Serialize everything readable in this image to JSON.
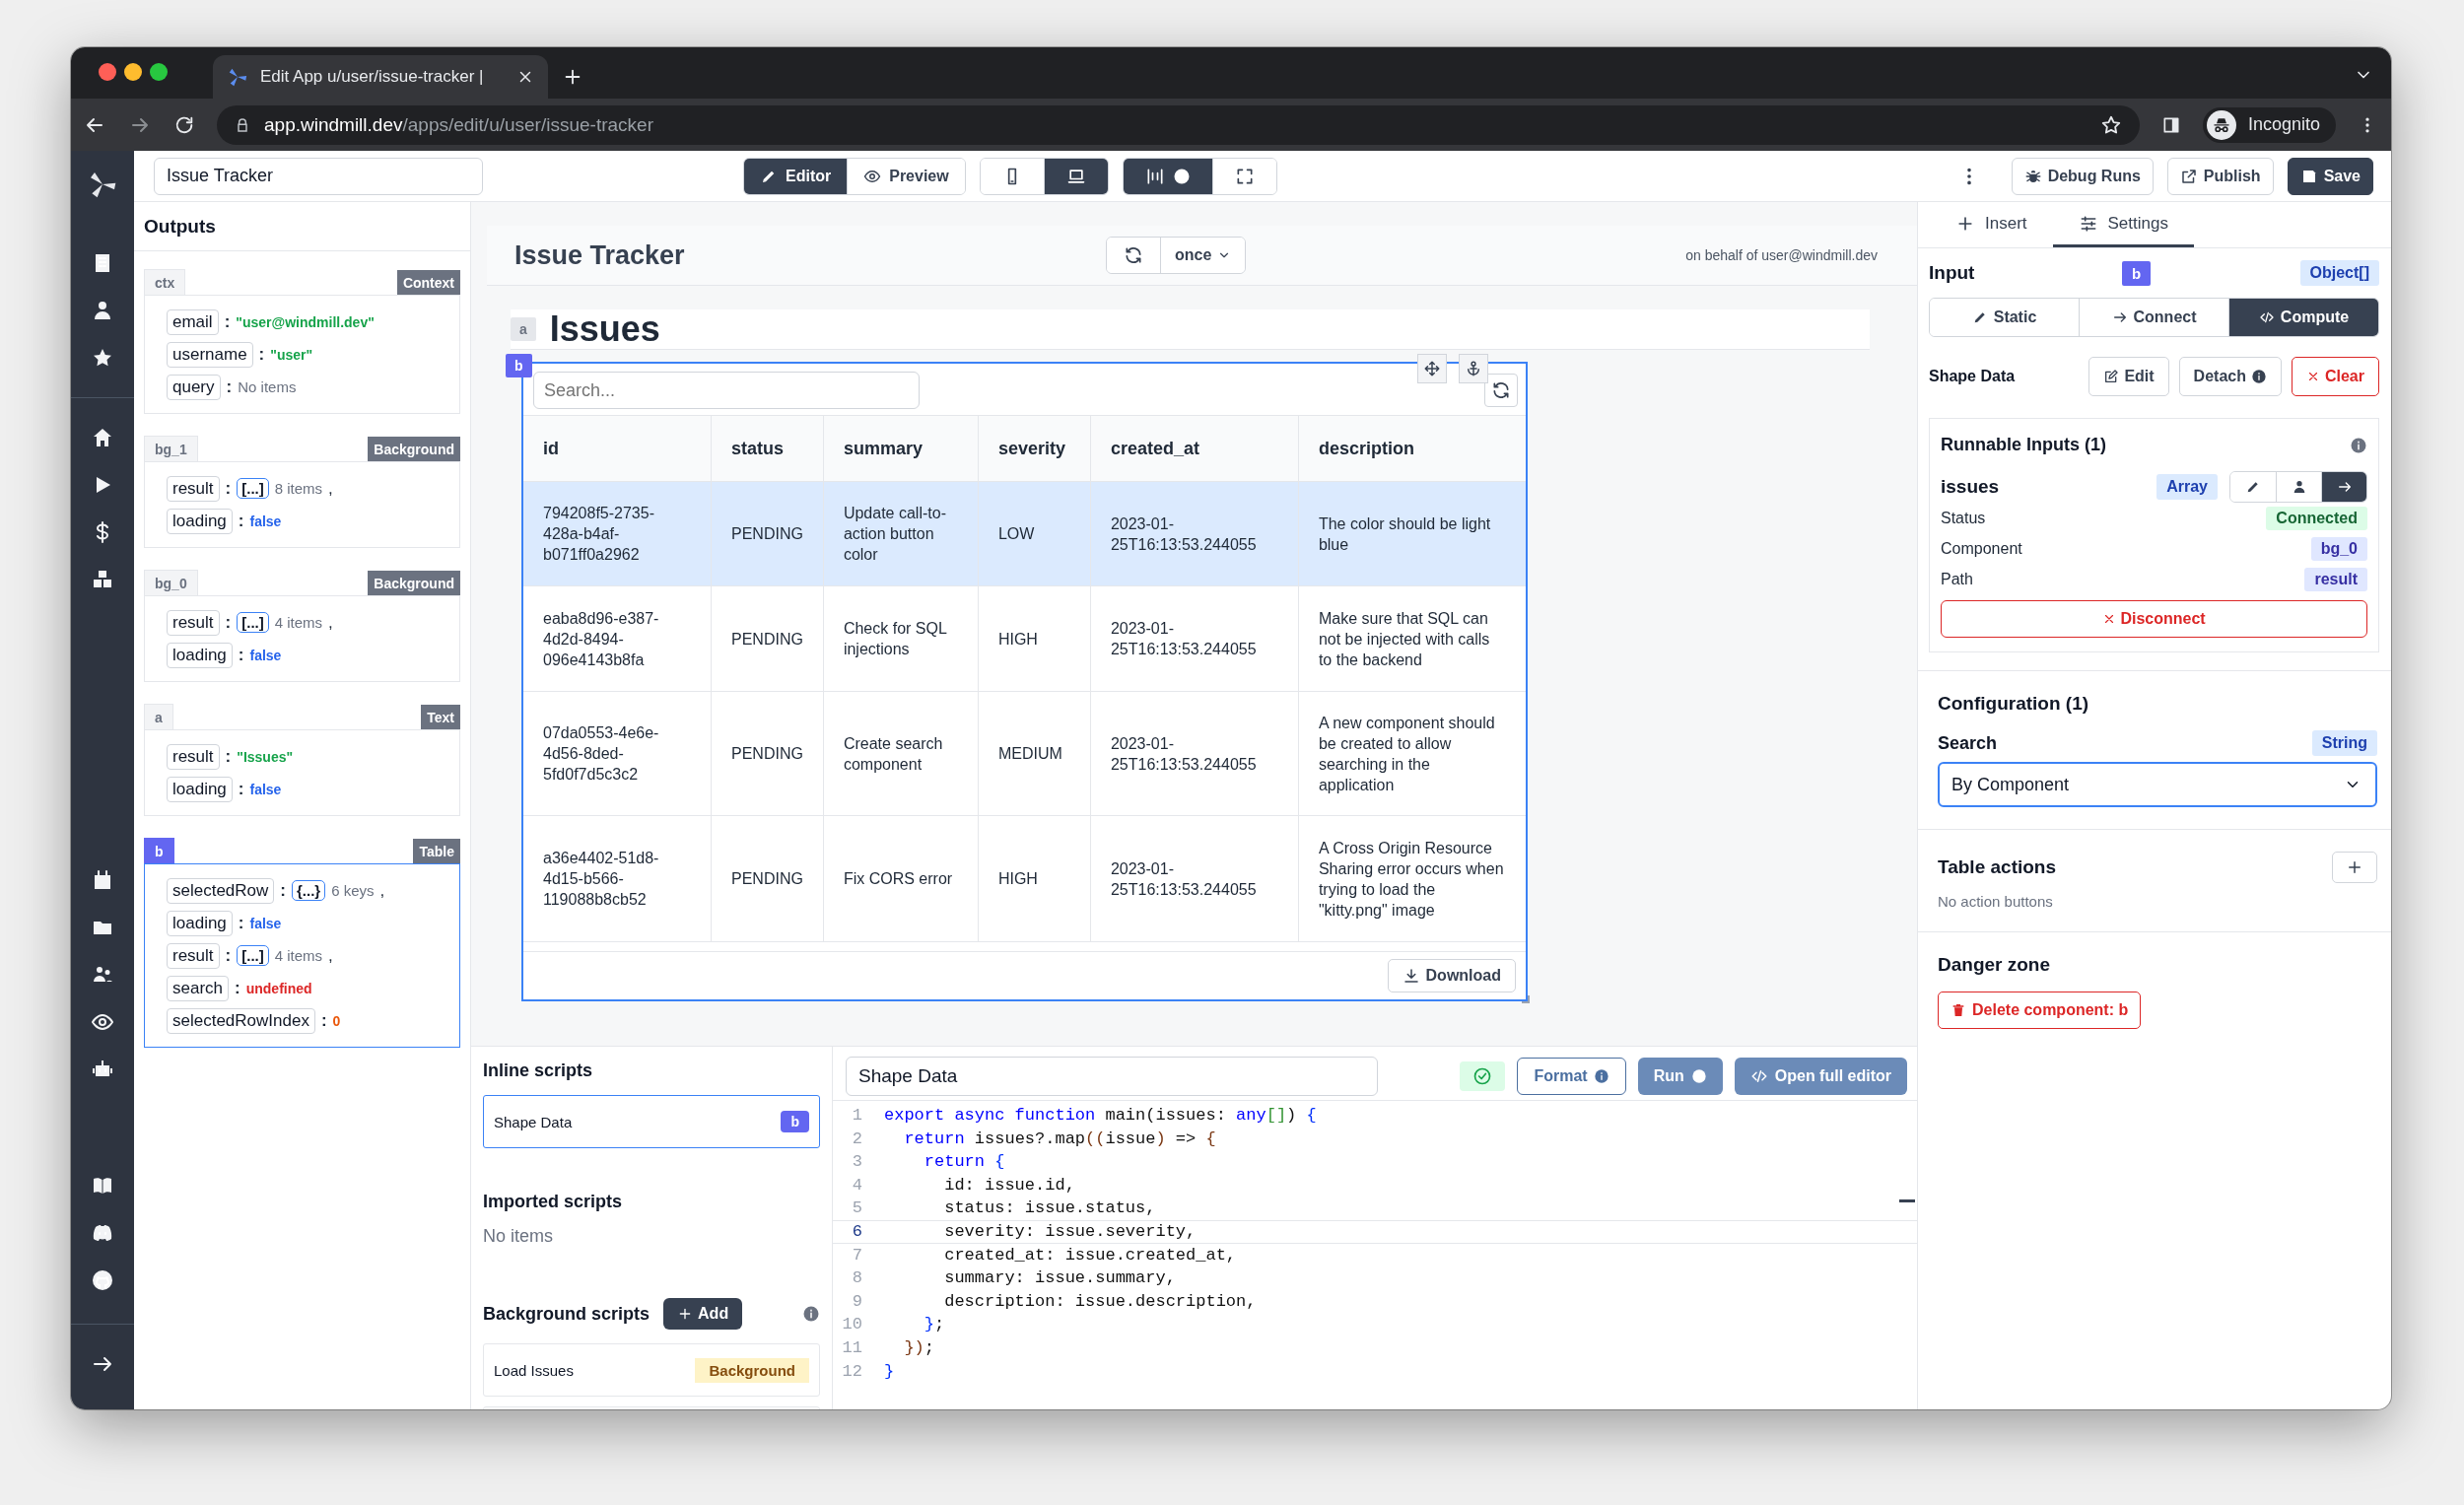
{
  "browser": {
    "tab_title": "Edit App u/user/issue-tracker |",
    "url_host": "app.windmill.dev",
    "url_path": "/apps/edit/u/user/issue-tracker",
    "profile": "Incognito"
  },
  "toolbar": {
    "app_name": "Issue Tracker",
    "modes": [
      {
        "label": "Editor",
        "kind": "editor",
        "selected": true
      },
      {
        "label": "Preview",
        "kind": "preview",
        "selected": false
      }
    ],
    "devices": [
      {
        "kind": "mobile",
        "selected": false
      },
      {
        "kind": "desktop",
        "selected": true
      }
    ],
    "actions": [
      {
        "label": "Debug Runs",
        "kind": "debug"
      },
      {
        "label": "Publish",
        "kind": "publish"
      },
      {
        "label": "Save",
        "kind": "save"
      }
    ]
  },
  "outputs": {
    "title": "Outputs",
    "separator": ":",
    "groups": [
      {
        "id": "ctx",
        "type": "Context",
        "selected": false,
        "fields": [
          {
            "key": "email",
            "kind": "string",
            "value": "\"user@windmill.dev\""
          },
          {
            "key": "username",
            "kind": "string",
            "value": "\"user\""
          },
          {
            "key": "query",
            "kind": "empty",
            "value": "No items"
          }
        ]
      },
      {
        "id": "bg_1",
        "type": "Background",
        "selected": false,
        "fields": [
          {
            "key": "result",
            "kind": "array",
            "value": "[...]",
            "count": "8 items",
            "trailing": ","
          },
          {
            "key": "loading",
            "kind": "boolean",
            "value": "false"
          }
        ]
      },
      {
        "id": "bg_0",
        "type": "Background",
        "selected": false,
        "fields": [
          {
            "key": "result",
            "kind": "array",
            "value": "[...]",
            "count": "4 items",
            "trailing": ","
          },
          {
            "key": "loading",
            "kind": "boolean",
            "value": "false"
          }
        ]
      },
      {
        "id": "a",
        "type": "Text",
        "selected": false,
        "fields": [
          {
            "key": "result",
            "kind": "string",
            "value": "\"Issues\""
          },
          {
            "key": "loading",
            "kind": "boolean",
            "value": "false"
          }
        ]
      },
      {
        "id": "b",
        "type": "Table",
        "selected": true,
        "fields": [
          {
            "key": "selectedRow",
            "kind": "object",
            "value": "{...}",
            "count": "6 keys",
            "trailing": ","
          },
          {
            "key": "loading",
            "kind": "boolean",
            "value": "false"
          },
          {
            "key": "result",
            "kind": "array",
            "value": "[...]",
            "count": "4 items",
            "trailing": ","
          },
          {
            "key": "search",
            "kind": "undefined",
            "value": "undefined"
          },
          {
            "key": "selectedRowIndex",
            "kind": "number",
            "value": "0"
          }
        ]
      }
    ]
  },
  "canvas": {
    "title": "Issue Tracker",
    "refresh": "once",
    "run_as": "on behalf of user@windmill.dev",
    "text_component": {
      "id": "a",
      "text": "Issues"
    },
    "table": {
      "id": "b",
      "selected": true,
      "search_placeholder": "Search...",
      "columns": [
        "id",
        "status",
        "summary",
        "severity",
        "created_at",
        "description"
      ],
      "rows": [
        {
          "selected": true,
          "cells": [
            "794208f5-2735-428a-b4af-b071ff0a2962",
            "PENDING",
            "Update call-to-action button color",
            "LOW",
            "2023-01-25T16:13:53.244055",
            "The color should be light blue"
          ]
        },
        {
          "selected": false,
          "cells": [
            "eaba8d96-e387-4d2d-8494-096e4143b8fa",
            "PENDING",
            "Check for SQL injections",
            "HIGH",
            "2023-01-25T16:13:53.244055",
            "Make sure that SQL can not be injected with calls to the backend"
          ]
        },
        {
          "selected": false,
          "cells": [
            "07da0553-4e6e-4d56-8ded-5fd0f7d5c3c2",
            "PENDING",
            "Create search component",
            "MEDIUM",
            "2023-01-25T16:13:53.244055",
            "A new component should be created to allow searching in the application"
          ]
        },
        {
          "selected": false,
          "cells": [
            "a36e4402-51d8-4d15-b566-119088b8cb52",
            "PENDING",
            "Fix CORS error",
            "HIGH",
            "2023-01-25T16:13:53.244055",
            "A Cross Origin Resource Sharing error occurs when trying to load the \"kitty.png\" image"
          ]
        }
      ],
      "download": "Download"
    }
  },
  "scripts": {
    "inline_title": "Inline scripts",
    "inline": [
      {
        "name": "Shape Data",
        "component": "b",
        "selected": true
      }
    ],
    "imported_title": "Imported scripts",
    "imported_empty": "No items",
    "background_title": "Background scripts",
    "add_label": "Add",
    "background": [
      {
        "name": "Load Issues",
        "tag": "Background"
      }
    ]
  },
  "editor": {
    "script_name": "Shape Data",
    "format": "Format",
    "run": "Run",
    "open_full": "Open full editor",
    "lines": [
      {
        "number": "1",
        "current": false,
        "segments": [
          {
            "text": "export async function",
            "kind": "kw"
          },
          {
            "text": " main(issues: ",
            "kind": "plain"
          },
          {
            "text": "any",
            "kind": "kw"
          },
          {
            "text": "[]",
            "kind": "br3"
          },
          {
            "text": ") ",
            "kind": "plain"
          },
          {
            "text": "{",
            "kind": "br1"
          }
        ]
      },
      {
        "number": "2",
        "current": false,
        "segments": [
          {
            "text": "  return",
            "kind": "kw"
          },
          {
            "text": " issues?.map",
            "kind": "plain"
          },
          {
            "text": "((",
            "kind": "br2"
          },
          {
            "text": "issue",
            "kind": "plain"
          },
          {
            "text": ")",
            "kind": "br2"
          },
          {
            "text": " => ",
            "kind": "plain"
          },
          {
            "text": "{",
            "kind": "br2"
          }
        ]
      },
      {
        "number": "3",
        "current": false,
        "segments": [
          {
            "text": "    return",
            "kind": "kw"
          },
          {
            "text": " {",
            "kind": "br1"
          }
        ]
      },
      {
        "number": "4",
        "current": false,
        "segments": [
          {
            "text": "      id: issue.id,",
            "kind": "plain"
          }
        ]
      },
      {
        "number": "5",
        "current": false,
        "segments": [
          {
            "text": "      status: issue.status,",
            "kind": "plain"
          }
        ]
      },
      {
        "number": "6",
        "current": true,
        "segments": [
          {
            "text": "      severity: issue.severity,",
            "kind": "plain"
          }
        ]
      },
      {
        "number": "7",
        "current": false,
        "segments": [
          {
            "text": "      created_at: issue.created_at,",
            "kind": "plain"
          }
        ]
      },
      {
        "number": "8",
        "current": false,
        "segments": [
          {
            "text": "      summary: issue.summary,",
            "kind": "plain"
          }
        ]
      },
      {
        "number": "9",
        "current": false,
        "segments": [
          {
            "text": "      description: issue.description,",
            "kind": "plain"
          }
        ]
      },
      {
        "number": "10",
        "current": false,
        "segments": [
          {
            "text": "    }",
            "kind": "br1"
          },
          {
            "text": ";",
            "kind": "plain"
          }
        ]
      },
      {
        "number": "11",
        "current": false,
        "segments": [
          {
            "text": "  })",
            "kind": "br2"
          },
          {
            "text": ";",
            "kind": "plain"
          }
        ]
      },
      {
        "number": "12",
        "current": false,
        "segments": [
          {
            "text": "}",
            "kind": "br1"
          }
        ]
      }
    ]
  },
  "settings_panel": {
    "tabs": [
      {
        "label": "Insert",
        "kind": "insert",
        "selected": false
      },
      {
        "label": "Settings",
        "kind": "settings",
        "selected": true
      }
    ],
    "input": {
      "title": "Input",
      "component": "b",
      "type": "Object[]",
      "modes": [
        {
          "label": "Static",
          "kind": "static",
          "selected": false
        },
        {
          "label": "Connect",
          "kind": "connect",
          "selected": false
        },
        {
          "label": "Compute",
          "kind": "compute",
          "selected": true
        }
      ],
      "script_label": "Shape Data",
      "script_actions": [
        {
          "label": "Edit",
          "kind": "edit"
        },
        {
          "label": "Detach",
          "kind": "detach"
        },
        {
          "label": "Clear",
          "kind": "clear"
        }
      ]
    },
    "runnable_inputs": {
      "title": "Runnable Inputs (1)",
      "items": [
        {
          "name": "issues",
          "type": "Array",
          "modes": [
            {
              "kind": "static",
              "selected": false
            },
            {
              "kind": "user",
              "selected": false
            },
            {
              "kind": "connect",
              "selected": true
            }
          ],
          "props": [
            {
              "label": "Status",
              "value": "Connected",
              "kind": "status"
            },
            {
              "label": "Component",
              "value": "bg_0",
              "kind": "ref"
            },
            {
              "label": "Path",
              "value": "result",
              "kind": "ref"
            }
          ],
          "disconnect": "Disconnect"
        }
      ]
    },
    "configuration": {
      "title": "Configuration (1)",
      "fields": [
        {
          "label": "Search",
          "type": "String",
          "value": "By Component"
        }
      ]
    },
    "table_actions": {
      "title": "Table actions",
      "empty": "No action buttons"
    },
    "danger_zone": {
      "title": "Danger zone",
      "delete_label": "Delete component: b"
    }
  }
}
